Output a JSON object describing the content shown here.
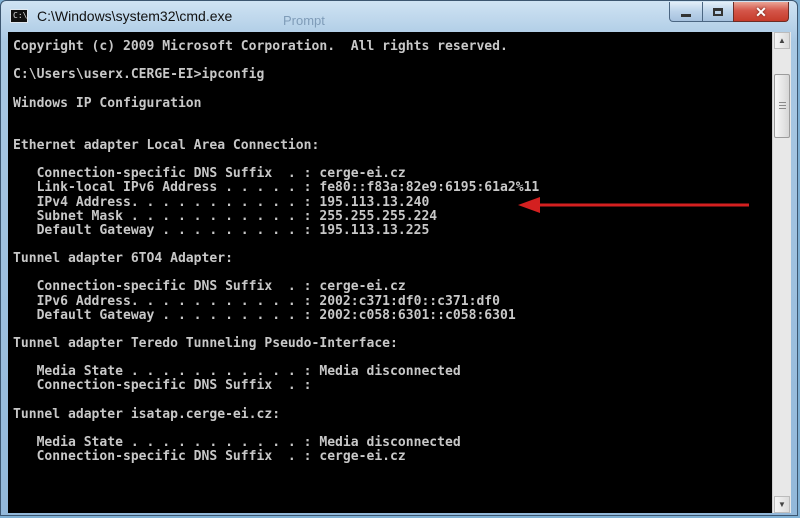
{
  "window": {
    "title": "C:\\Windows\\system32\\cmd.exe",
    "icon_label": "C:\\",
    "ghost_text": "Prompt",
    "caption_buttons": {
      "minimize": "minimize",
      "maximize": "maximize",
      "close": "✕"
    }
  },
  "console": {
    "lines": [
      "Copyright (c) 2009 Microsoft Corporation.  All rights reserved.",
      "",
      "C:\\Users\\userx.CERGE-EI>ipconfig",
      "",
      "Windows IP Configuration",
      "",
      "",
      "Ethernet adapter Local Area Connection:",
      "",
      "   Connection-specific DNS Suffix  . : cerge-ei.cz",
      "   Link-local IPv6 Address . . . . . : fe80::f83a:82e9:6195:61a2%11",
      "   IPv4 Address. . . . . . . . . . . : 195.113.13.240",
      "   Subnet Mask . . . . . . . . . . . : 255.255.255.224",
      "   Default Gateway . . . . . . . . . : 195.113.13.225",
      "",
      "Tunnel adapter 6TO4 Adapter:",
      "",
      "   Connection-specific DNS Suffix  . : cerge-ei.cz",
      "   IPv6 Address. . . . . . . . . . . : 2002:c371:df0::c371:df0",
      "   Default Gateway . . . . . . . . . : 2002:c058:6301::c058:6301",
      "",
      "Tunnel adapter Teredo Tunneling Pseudo-Interface:",
      "",
      "   Media State . . . . . . . . . . . : Media disconnected",
      "   Connection-specific DNS Suffix  . :",
      "",
      "Tunnel adapter isatap.cerge-ei.cz:",
      "",
      "   Media State . . . . . . . . . . . : Media disconnected",
      "   Connection-specific DNS Suffix  . : cerge-ei.cz"
    ]
  },
  "colors": {
    "console_bg": "#000000",
    "console_text": "#c8c8c8",
    "arrow": "#d42020",
    "titlebar": "#a9c8e3"
  },
  "icons": {
    "arrow": "left-arrow-icon",
    "scroll_up": "chevron-up-icon",
    "scroll_down": "chevron-down-icon"
  }
}
